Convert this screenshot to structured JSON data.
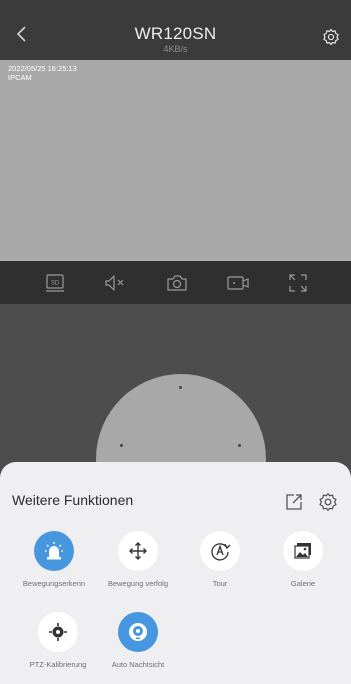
{
  "header": {
    "title": "WR120SN",
    "subtitle": "4KB/s"
  },
  "video": {
    "osd_timestamp": "2022/05/25  16:25:13",
    "osd_label": "IPCAM"
  },
  "toolbar": {
    "sd_badge": "SD"
  },
  "sheet": {
    "title": "Weitere Funktionen"
  },
  "features": [
    {
      "label": "Bewegungserkenn",
      "icon": "siren-icon",
      "active": true
    },
    {
      "label": "Bewegung verfolg",
      "icon": "move-arrows-icon",
      "active": false
    },
    {
      "label": "Tour",
      "icon": "tour-icon",
      "active": false
    },
    {
      "label": "Galerie",
      "icon": "gallery-icon",
      "active": false
    },
    {
      "label": "PTZ-Kalibrierung",
      "icon": "calibration-icon",
      "active": false
    },
    {
      "label": "Auto Nachtsicht",
      "icon": "night-vision-icon",
      "active": true
    }
  ],
  "colors": {
    "accent": "#4797df",
    "sheet_background": "#efeff1",
    "header_background": "#3b3b3b",
    "toolbar_background": "#2f2f2f"
  }
}
